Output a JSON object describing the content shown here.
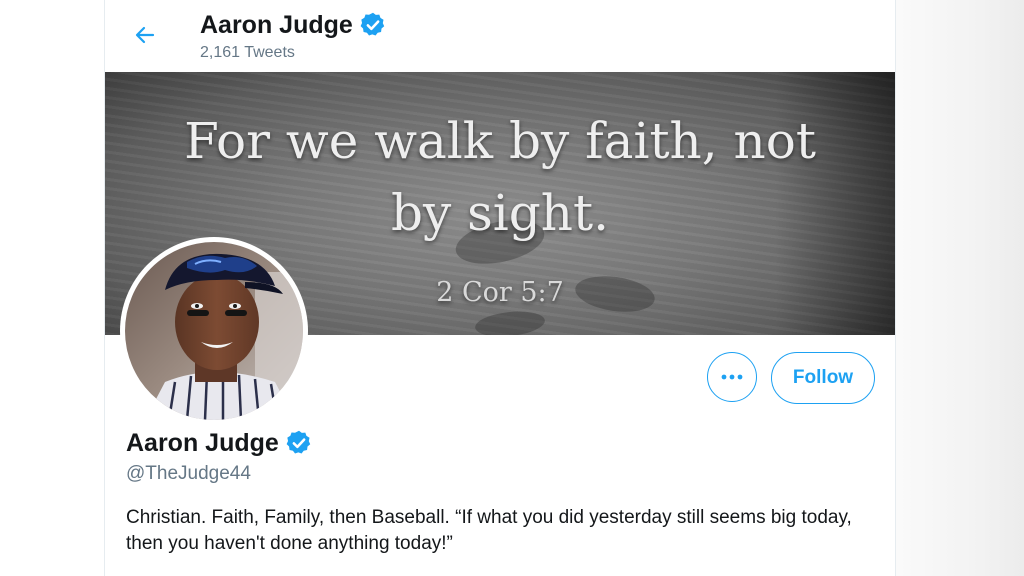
{
  "header": {
    "name": "Aaron Judge",
    "tweet_count": "2,161 Tweets"
  },
  "banner": {
    "line1": "For we walk by faith, not",
    "line2": "by sight.",
    "reference": "2 Cor 5:7"
  },
  "profile": {
    "name": "Aaron Judge",
    "handle": "@TheJudge44",
    "bio_line1": "Christian. Faith, Family, then Baseball. “If what you did yesterday still seems big today,",
    "bio_line2": "then you haven't done anything today!”",
    "verified": true
  },
  "actions": {
    "more_label": "•••",
    "follow_label": "Follow"
  },
  "colors": {
    "accent": "#1da1f2",
    "secondary_text": "#657786",
    "primary_text": "#14171a"
  },
  "icons": {
    "back": "back-arrow-icon",
    "verified": "verified-badge-icon",
    "more": "more-dots-icon"
  }
}
